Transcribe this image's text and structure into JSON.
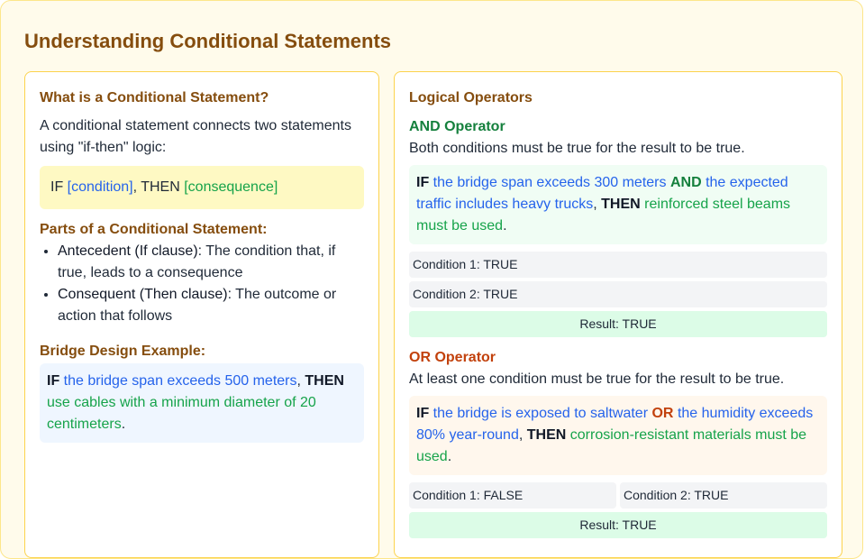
{
  "title": "Understanding Conditional Statements",
  "left": {
    "heading": "What is a Conditional Statement?",
    "intro": "A conditional statement connects two statements using \"if-then\" logic:",
    "formula": {
      "if": "IF",
      "condition": "[condition]",
      "comma_then": ", THEN",
      "consequence": "[consequence]"
    },
    "parts_heading": "Parts of a Conditional Statement:",
    "parts": [
      {
        "term": "Antecedent (If clause)",
        "desc": ": The condition that, if true, leads to a consequence"
      },
      {
        "term": "Consequent (Then clause)",
        "desc": ": The outcome or action that follows"
      }
    ],
    "example_heading": "Bridge Design Example:",
    "example": {
      "if": "IF",
      "condition": "the bridge span exceeds 500 meters",
      "comma": ",",
      "then": "THEN",
      "consequence": "use cables with a minimum diameter of 20 centimeters",
      "end": "."
    }
  },
  "right": {
    "heading": "Logical Operators",
    "and": {
      "heading": "AND Operator",
      "desc": "Both conditions must be true for the result to be true.",
      "example": {
        "if": "IF",
        "cond1": "the bridge span exceeds 300 meters",
        "op": "AND",
        "cond2": "the expected traffic includes heavy trucks",
        "comma": ",",
        "then": "THEN",
        "consequence": "reinforced steel beams must be used",
        "end": "."
      },
      "condition1": "Condition 1: TRUE",
      "condition2": "Condition 2: TRUE",
      "result": "Result: TRUE"
    },
    "or": {
      "heading": "OR Operator",
      "desc": "At least one condition must be true for the result to be true.",
      "example": {
        "if": "IF",
        "cond1": "the bridge is exposed to saltwater",
        "op": "OR",
        "cond2": "the humidity exceeds 80% year-round",
        "comma": ",",
        "then": "THEN",
        "consequence": "corrosion-resistant materials must be used",
        "end": "."
      },
      "condition1": "Condition 1: FALSE",
      "condition2": "Condition 2: TRUE",
      "result": "Result: TRUE"
    }
  }
}
